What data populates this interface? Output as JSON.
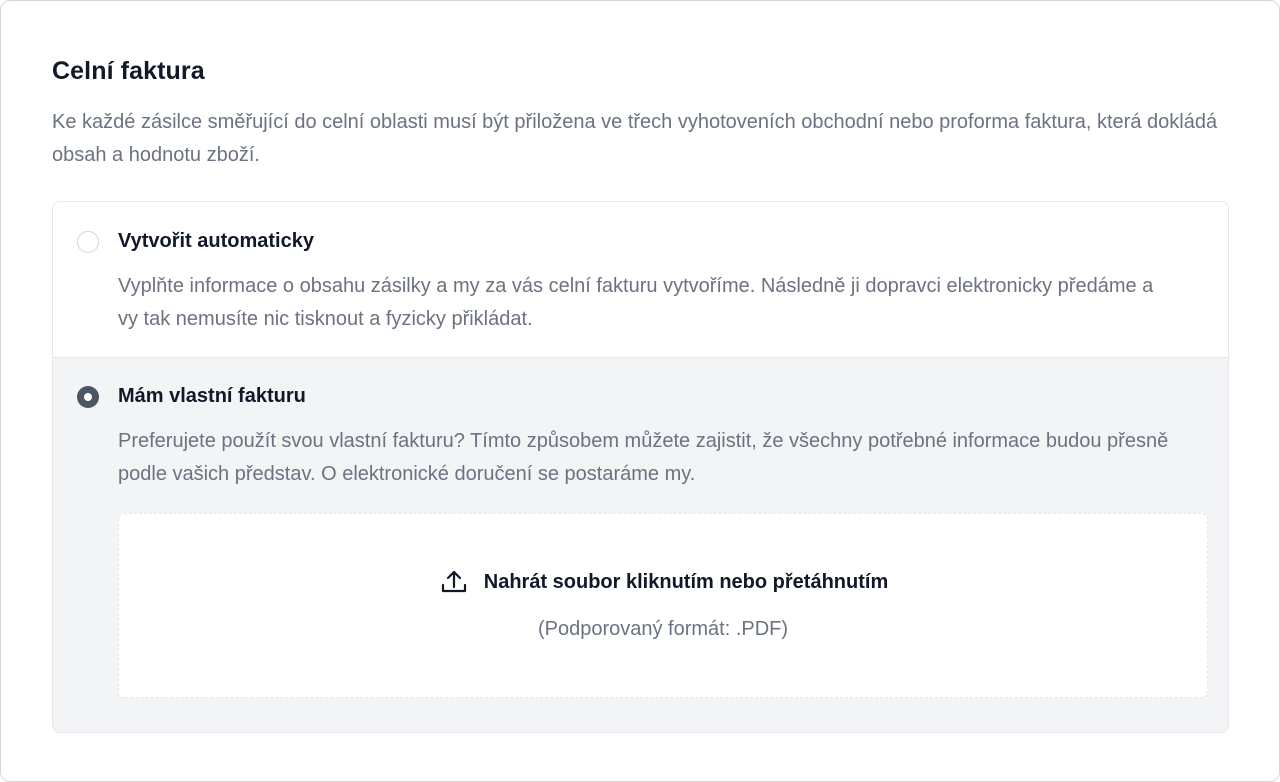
{
  "section": {
    "title": "Celní faktura",
    "description": "Ke každé zásilce směřující do celní oblasti musí být přiložena ve třech vyhotoveních obchodní nebo proforma faktura, která dokládá obsah a hodnotu zboží."
  },
  "options": [
    {
      "label": "Vytvořit automaticky",
      "description": "Vyplňte informace o obsahu zásilky a my za vás celní fakturu vytvoříme. Následně ji dopravci elektronicky předáme a vy tak nemusíte nic tisknout a fyzicky přikládat.",
      "selected": false
    },
    {
      "label": "Mám vlastní fakturu",
      "description": "Preferujete použít svou vlastní fakturu? Tímto způsobem můžete zajistit, že všechny potřebné informace budou přesně podle vašich představ. O elektronické doručení se postaráme my.",
      "selected": true
    }
  ],
  "upload": {
    "icon": "upload-icon",
    "label": "Nahrát soubor kliknutím nebo přetáhnutím",
    "hint": "(Podporovaný formát: .PDF)"
  },
  "colors": {
    "radio_selected": "#4b5563",
    "selected_background": "#f3f4f6",
    "muted_text": "#6b7280"
  }
}
